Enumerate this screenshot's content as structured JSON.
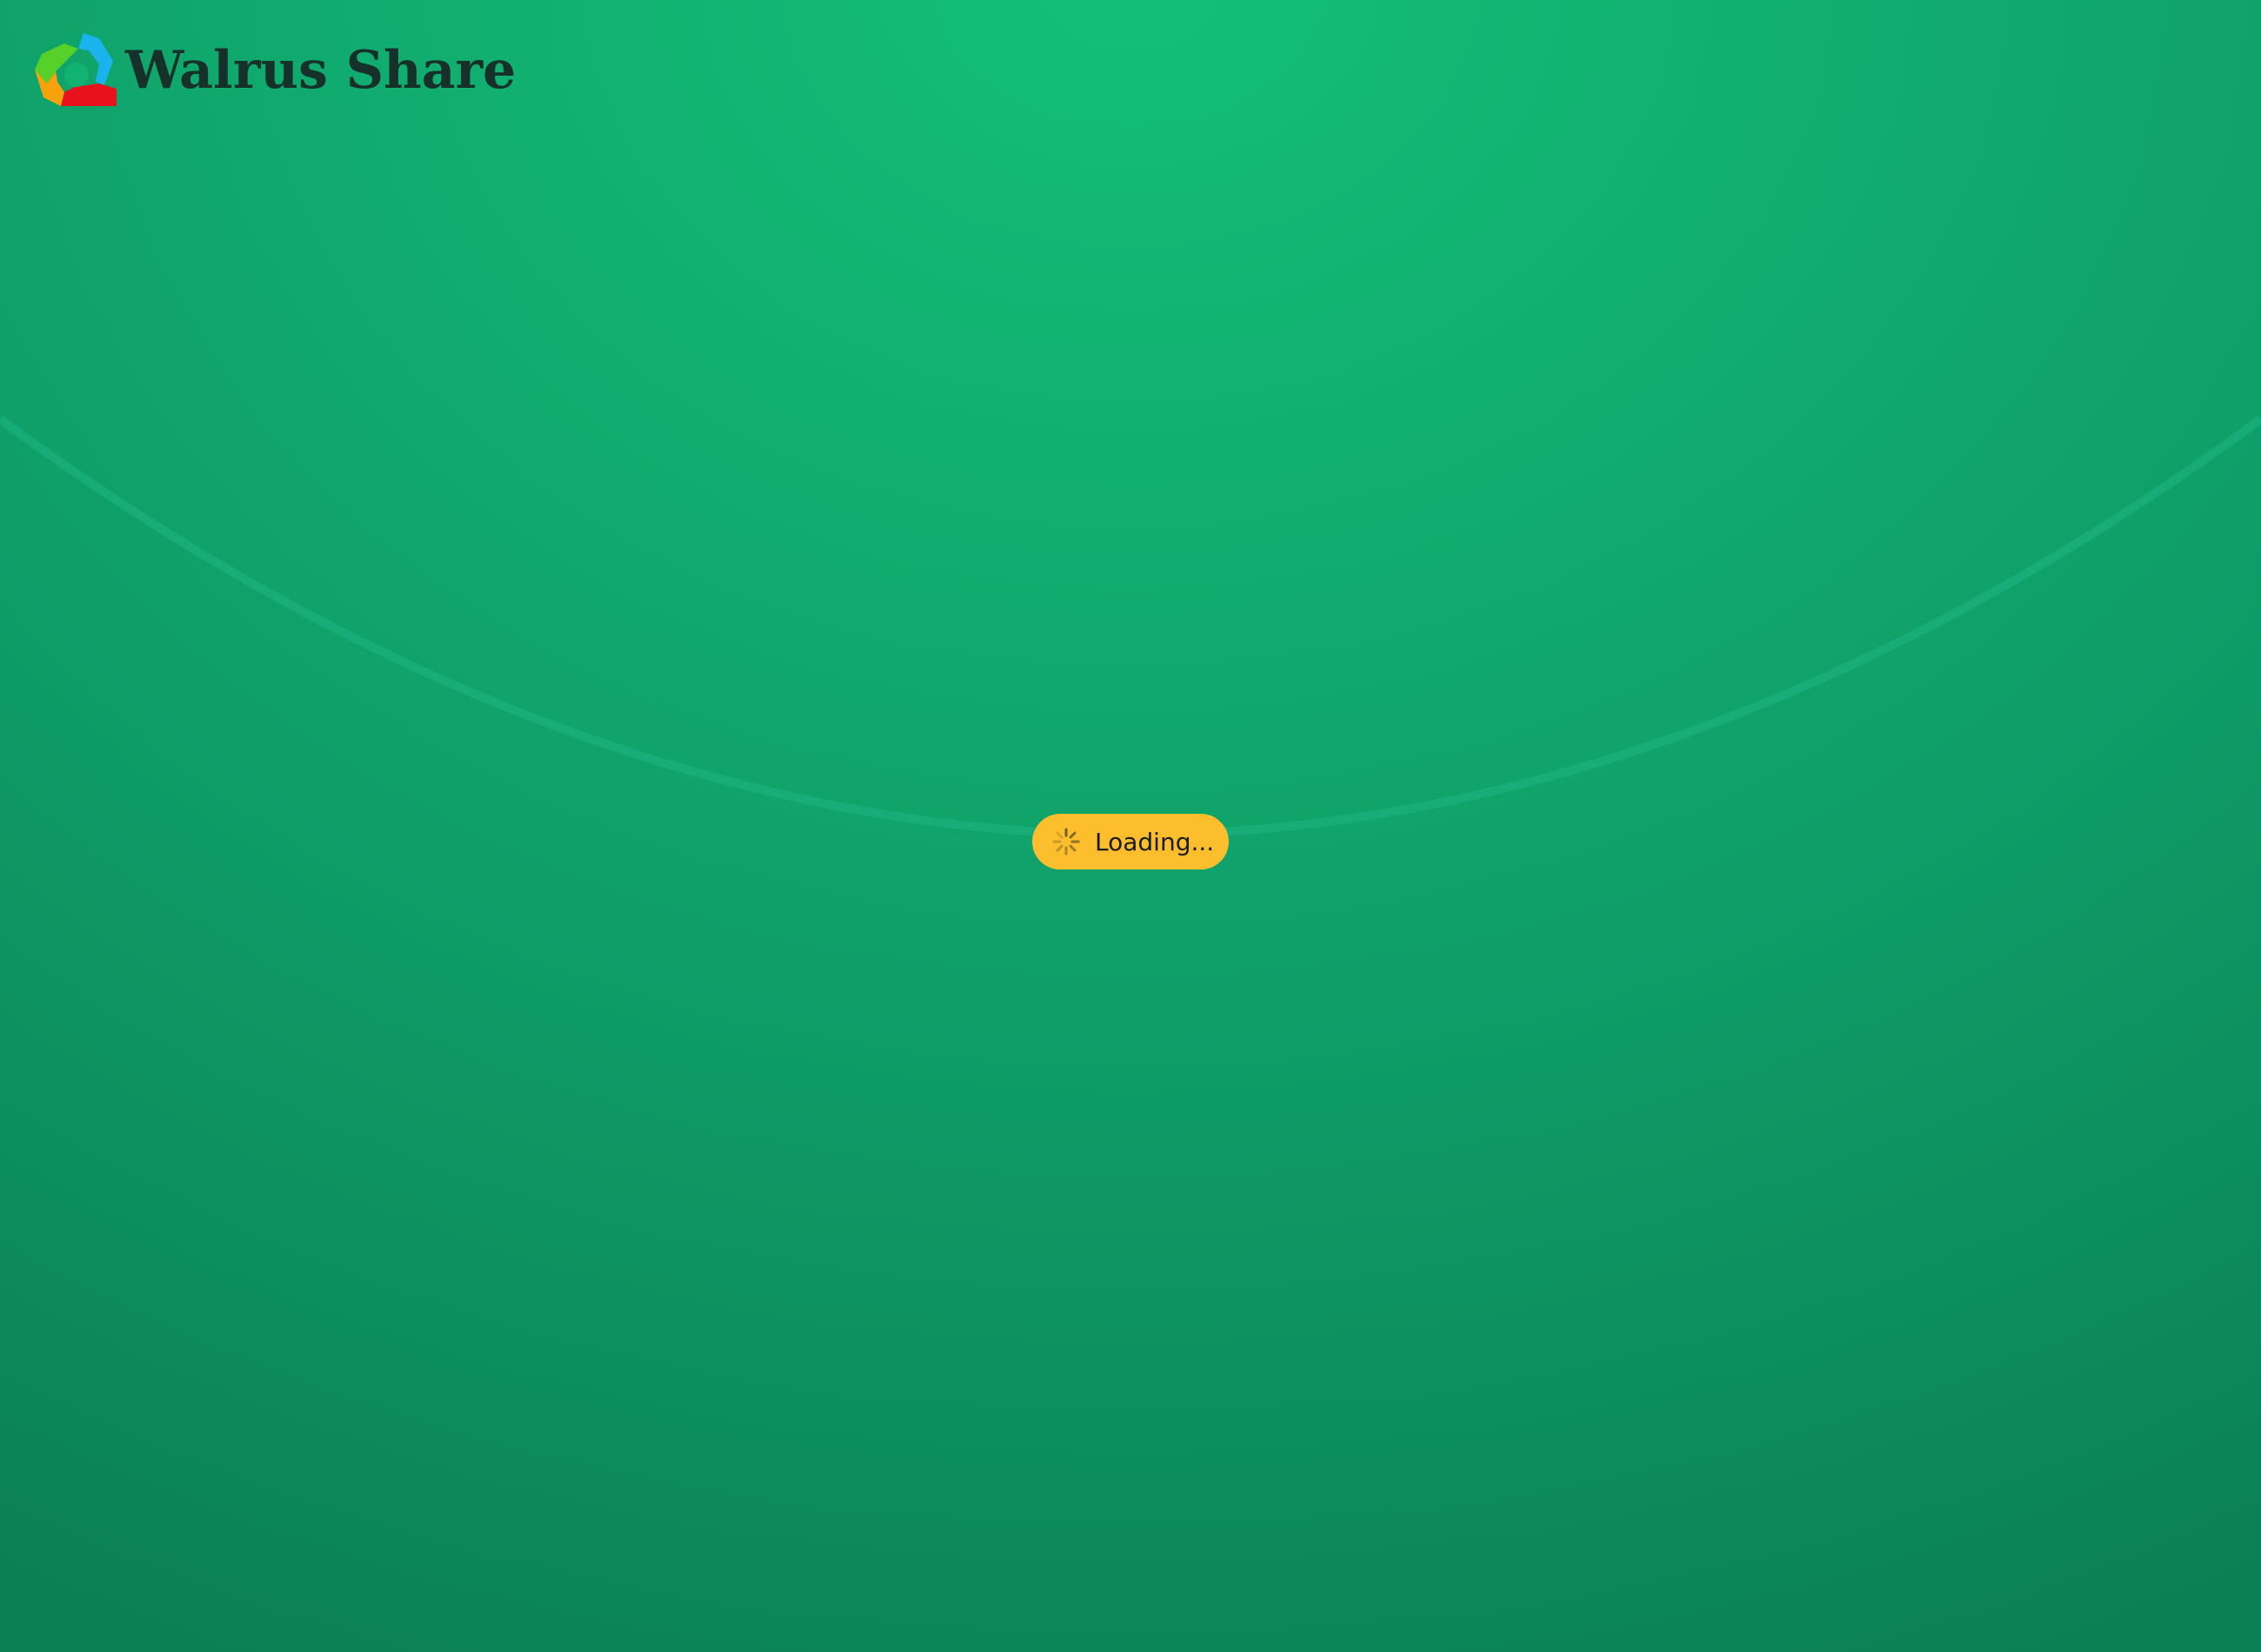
{
  "app": {
    "brand_name": "Walrus Share",
    "logo_icon": "walrus-share-logo-icon"
  },
  "status": {
    "loading_label": "Loading...",
    "spinner_icon": "spinner-icon"
  },
  "colors": {
    "background_top": "#13c078",
    "background_bottom": "#06704c",
    "loading_pill": "#fcbe2c",
    "brand_text": "#16302a",
    "logo_blue": "#1ab3ee",
    "logo_green": "#55d12a",
    "logo_orange": "#f5a20d",
    "logo_red": "#e8111c"
  }
}
